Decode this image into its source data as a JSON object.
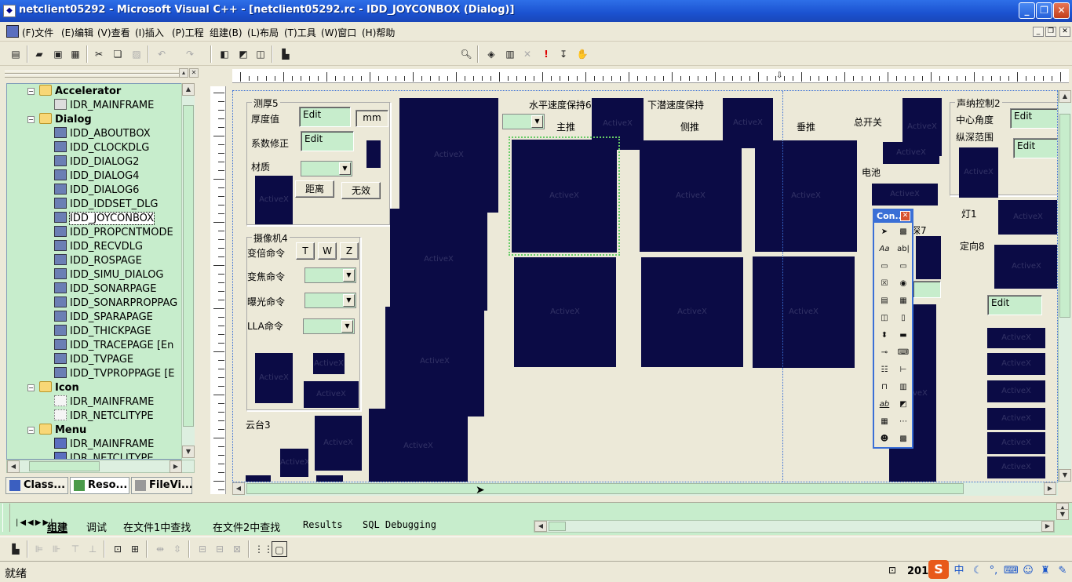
{
  "window": {
    "title": "netclient05292 - Microsoft Visual C++ - [netclient05292.rc - IDD_JOYCONBOX (Dialog)]"
  },
  "menu": [
    "(F)文件",
    "(E)编辑",
    "(V)查看",
    "(I)插入",
    "(P)工程",
    "组建(B)",
    "(L)布局",
    "(T)工具",
    "(W)窗口",
    "(H)帮助"
  ],
  "tree": {
    "items": [
      {
        "label": "Accelerator",
        "type": "folder",
        "bold": true
      },
      {
        "label": "IDR_MAINFRAME",
        "type": "accel"
      },
      {
        "label": "Dialog",
        "type": "folder",
        "bold": true
      },
      {
        "label": "IDD_ABOUTBOX",
        "type": "dlg"
      },
      {
        "label": "IDD_CLOCKDLG",
        "type": "dlg"
      },
      {
        "label": "IDD_DIALOG2",
        "type": "dlg"
      },
      {
        "label": "IDD_DIALOG4",
        "type": "dlg"
      },
      {
        "label": "IDD_DIALOG6",
        "type": "dlg"
      },
      {
        "label": "IDD_IDDSET_DLG",
        "type": "dlg"
      },
      {
        "label": "IDD_JOYCONBOX",
        "type": "dlg",
        "selected": true
      },
      {
        "label": "IDD_PROPCNTMODE",
        "type": "dlg"
      },
      {
        "label": "IDD_RECVDLG",
        "type": "dlg"
      },
      {
        "label": "IDD_ROSPAGE",
        "type": "dlg"
      },
      {
        "label": "IDD_SIMU_DIALOG",
        "type": "dlg"
      },
      {
        "label": "IDD_SONARPAGE",
        "type": "dlg"
      },
      {
        "label": "IDD_SONARPROPPAG",
        "type": "dlg"
      },
      {
        "label": "IDD_SPARAPAGE",
        "type": "dlg"
      },
      {
        "label": "IDD_THICKPAGE",
        "type": "dlg"
      },
      {
        "label": "IDD_TRACEPAGE [En",
        "type": "dlg"
      },
      {
        "label": "IDD_TVPAGE",
        "type": "dlg"
      },
      {
        "label": "IDD_TVPROPPAGE [E",
        "type": "dlg"
      },
      {
        "label": "Icon",
        "type": "folder",
        "bold": true
      },
      {
        "label": "IDR_MAINFRAME",
        "type": "icon"
      },
      {
        "label": "IDR_NETCLITYPE",
        "type": "icon"
      },
      {
        "label": "Menu",
        "type": "folder",
        "bold": true
      },
      {
        "label": "IDR_MAINFRAME",
        "type": "menu"
      },
      {
        "label": "IDR_NETCLITYPE",
        "type": "menu"
      }
    ]
  },
  "workspace_tabs": [
    "Class...",
    "Reso...",
    "FileVi..."
  ],
  "dialog": {
    "g_thick": "测厚5",
    "thick_label": "厚度值",
    "edit": "Edit",
    "mm": "mm",
    "coef_label": "系数修正",
    "material_label": "材质",
    "btn_dist": "距离",
    "btn_invalid": "无效",
    "g_camera": "摄像机4",
    "zoom_label": "变倍命令",
    "btn_t": "T",
    "btn_w": "W",
    "btn_z": "Z",
    "focus_label": "变焦命令",
    "exposure_label": "曝光命令",
    "lla_label": "LLA命令",
    "ptz_label": "云台3",
    "h_speed": "水平速度保持6",
    "main_push": "主推",
    "dive_speed": "下潜速度保持",
    "side_push": "侧推",
    "vert_push": "垂推",
    "master_switch": "总开关",
    "battery": "电池",
    "sonar": "声纳控制2",
    "center_angle": "中心角度",
    "depth_range": "纵深范围",
    "light": "灯1",
    "orient": "定向8",
    "group7": "深7",
    "activex": "ActiveX"
  },
  "palette": {
    "title": "Con..."
  },
  "output_tabs": [
    "组建",
    "调试",
    "在文件1中查找",
    "在文件2中查找",
    "Results",
    "SQL Debugging"
  ],
  "status": {
    "text": "就绪",
    "coords": "201,"
  },
  "colors": {
    "activex": "#0B0B45",
    "tree_bg": "#C7EDCC",
    "title_blue": "#1B52D0"
  }
}
